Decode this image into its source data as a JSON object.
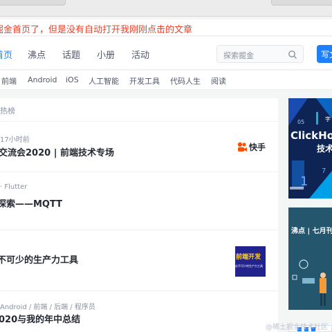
{
  "notice": {
    "text": "掘金首页了，但是没有自动打开我刚刚点击的文章"
  },
  "nav": {
    "items": [
      "首页",
      "沸点",
      "话题",
      "小册",
      "活动"
    ],
    "search_placeholder": "探索掘金",
    "write_label": "写文章"
  },
  "categories": [
    "前端",
    "Android",
    "iOS",
    "人工智能",
    "开发工具",
    "代码人生",
    "阅读"
  ],
  "feed": {
    "header": "热榜",
    "items": [
      {
        "meta": "17小时前",
        "title": "交流会2020 | 前端技术专场",
        "thumb": "快手"
      },
      {
        "meta": "· Flutter",
        "title": "探索——MQTT",
        "thumb": ""
      },
      {
        "meta": "",
        "title": "不可少的生产力工具",
        "thumb": "前端开发",
        "thumb_sub": "必不可少的生产力工具"
      },
      {
        "meta": "Android / 前端 / 后端 / 程序员",
        "title": "020与我的年中总结",
        "thumb": ""
      }
    ]
  },
  "sidebar": {
    "card1_title": "ClickHou",
    "card1_sub": "技术",
    "card1_small": "字",
    "card1_numbers": [
      "05",
      "1",
      "7"
    ],
    "card2_label": "沸点 | 七月刊"
  },
  "watermark": "@稀土掘金技术社区",
  "colors": {
    "accent": "#1e80ff",
    "notice": "#e8432e",
    "kuaishou": "#ff5000"
  }
}
